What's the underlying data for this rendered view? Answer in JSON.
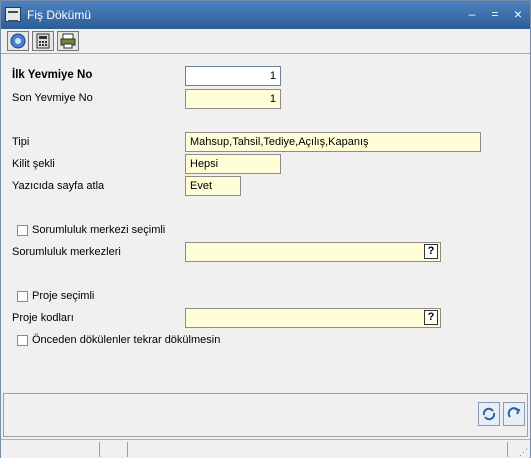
{
  "window": {
    "title": "Fiş Dökümü",
    "controls": {
      "minimize": "–",
      "maximize": "=",
      "close": "×"
    }
  },
  "toolbar": {
    "items": [
      {
        "name": "help",
        "icon": "help-icon"
      },
      {
        "name": "calculator",
        "icon": "calculator-icon"
      },
      {
        "name": "print",
        "icon": "printer-icon"
      }
    ]
  },
  "form": {
    "ilk_yevmiye": {
      "label": "İlk Yevmiye No",
      "value": "1"
    },
    "son_yevmiye": {
      "label": "Son Yevmiye No",
      "value": "1"
    },
    "tipi": {
      "label": "Tipi",
      "value": "Mahsup,Tahsil,Tediye,Açılış,Kapanış"
    },
    "kilit": {
      "label": "Kilit şekli",
      "value": "Hepsi"
    },
    "yazicida": {
      "label": "Yazıcıda sayfa atla",
      "value": "Evet"
    },
    "sorumluluk_check": {
      "label": "Sorumluluk merkezi seçimli",
      "checked": false
    },
    "sorumluluk_merkezleri": {
      "label": "Sorumluluk merkezleri",
      "value": "",
      "lookup": "?"
    },
    "proje_check": {
      "label": "Proje seçimli",
      "checked": false
    },
    "proje_kodlari": {
      "label": "Proje kodları",
      "value": "",
      "lookup": "?"
    },
    "onceden_check": {
      "label": "Önceden dökülenler tekrar dökülmesin",
      "checked": false
    }
  },
  "colors": {
    "titlebar": "#3a6ea5",
    "field_bg": "#fffed6",
    "window_bg": "#f0f0f0"
  }
}
